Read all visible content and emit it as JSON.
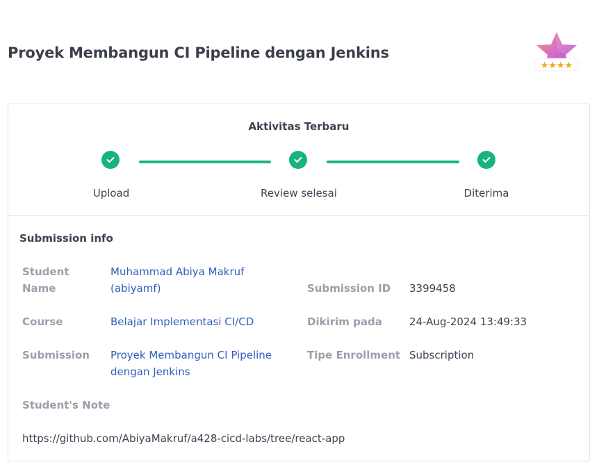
{
  "header": {
    "title": "Proyek Membangun CI Pipeline dengan Jenkins",
    "rating_icon": "star-badge-icon",
    "rating_stars": 4
  },
  "activity": {
    "title": "Aktivitas Terbaru",
    "steps": [
      {
        "label": "Upload",
        "status": "done"
      },
      {
        "label": "Review selesai",
        "status": "done"
      },
      {
        "label": "Diterima",
        "status": "done"
      }
    ],
    "accent_color": "#18b47c"
  },
  "submission": {
    "title": "Submission info",
    "student_name_label": "Student Name",
    "student_name_line1": "Muhammad Abiya Makruf",
    "student_name_line2": "(abiyamf)",
    "course_label": "Course",
    "course_value": "Belajar Implementasi CI/CD",
    "submission_label": "Submission",
    "submission_line1": "Proyek Membangun CI Pipeline",
    "submission_line2": "dengan Jenkins",
    "submission_id_label": "Submission ID",
    "submission_id_value": "3399458",
    "sent_label": "Dikirim pada",
    "sent_value": "24-Aug-2024 13:49:33",
    "enrollment_label": "Tipe Enrollment",
    "enrollment_value": "Subscription",
    "note_label": "Student's Note",
    "note_value": "https://github.com/AbiyaMakruf/a428-cicd-labs/tree/react-app"
  }
}
